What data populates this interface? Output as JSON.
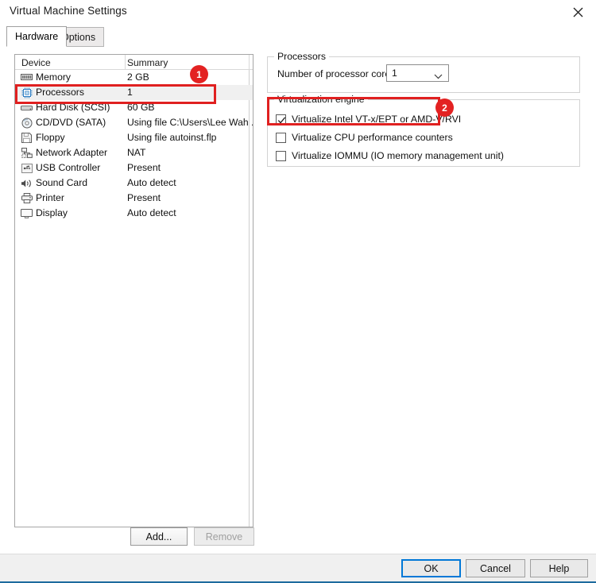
{
  "window": {
    "title": "Virtual Machine Settings",
    "close_icon": "close-icon"
  },
  "tabs": [
    {
      "label": "Hardware",
      "active": true
    },
    {
      "label": "Options",
      "active": false
    }
  ],
  "device_list": {
    "columns": [
      "Device",
      "Summary"
    ],
    "rows": [
      {
        "icon": "memory-icon",
        "device": "Memory",
        "summary": "2 GB",
        "selected": false
      },
      {
        "icon": "processor-icon",
        "device": "Processors",
        "summary": "1",
        "selected": true
      },
      {
        "icon": "hard-disk-icon",
        "device": "Hard Disk (SCSI)",
        "summary": "60 GB",
        "selected": false
      },
      {
        "icon": "cd-dvd-icon",
        "device": "CD/DVD (SATA)",
        "summary": "Using file C:\\Users\\Lee Wah ...",
        "selected": false
      },
      {
        "icon": "floppy-icon",
        "device": "Floppy",
        "summary": "Using file autoinst.flp",
        "selected": false
      },
      {
        "icon": "network-adapter-icon",
        "device": "Network Adapter",
        "summary": "NAT",
        "selected": false
      },
      {
        "icon": "usb-controller-icon",
        "device": "USB Controller",
        "summary": "Present",
        "selected": false
      },
      {
        "icon": "sound-card-icon",
        "device": "Sound Card",
        "summary": "Auto detect",
        "selected": false
      },
      {
        "icon": "printer-icon",
        "device": "Printer",
        "summary": "Present",
        "selected": false
      },
      {
        "icon": "display-icon",
        "device": "Display",
        "summary": "Auto detect",
        "selected": false
      }
    ]
  },
  "list_buttons": {
    "add_label": "Add...",
    "remove_label": "Remove"
  },
  "processors_group": {
    "legend": "Processors",
    "cores_label": "Number of processor cores:",
    "cores_value": "1",
    "chevron_icon": "chevron-down-icon"
  },
  "virtualization_group": {
    "legend": "Virtualization engine",
    "checkboxes": [
      {
        "label": "Virtualize Intel VT-x/EPT or AMD-V/RVI",
        "checked": true
      },
      {
        "label": "Virtualize CPU performance counters",
        "checked": false
      },
      {
        "label": "Virtualize IOMMU (IO memory management unit)",
        "checked": false
      }
    ]
  },
  "footer": {
    "ok_label": "OK",
    "cancel_label": "Cancel",
    "help_label": "Help"
  },
  "annotations": [
    {
      "badge": "1",
      "target": "processors-row"
    },
    {
      "badge": "2",
      "target": "virtualize-vtx-checkbox"
    }
  ],
  "colors": {
    "annotation_red": "#e32222",
    "focus_blue": "#0078d7",
    "accent_bar": "#1d6b9e",
    "selection_gray": "#f0f0f0"
  }
}
